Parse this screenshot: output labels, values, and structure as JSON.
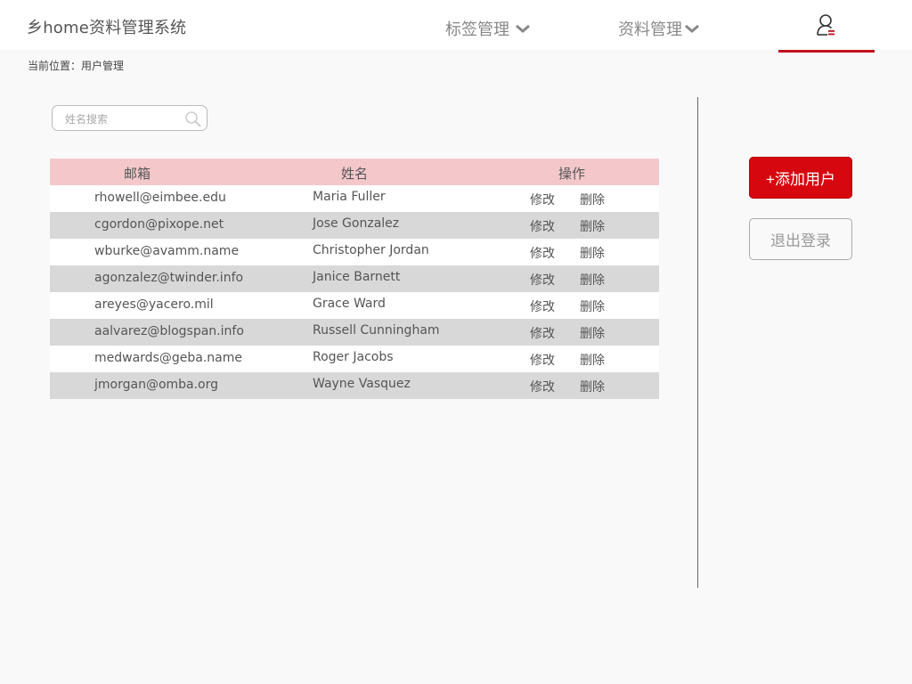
{
  "app": {
    "title": "乡home资料管理系统"
  },
  "nav": {
    "tags_label": "标签管理",
    "data_label": "资料管理",
    "user_icon": "user-icon",
    "accent_color": "#c0111f"
  },
  "breadcrumb": {
    "text": "当前位置：用户管理"
  },
  "search": {
    "placeholder": "姓名搜索",
    "value": ""
  },
  "table": {
    "columns": [
      "邮箱",
      "姓名",
      "操作"
    ],
    "rows": [
      {
        "email": "rhowell@eimbee.edu",
        "name": "Maria Fuller",
        "edit": "修改",
        "delete": "删除"
      },
      {
        "email": "cgordon@pixope.net",
        "name": "Jose Gonzalez",
        "edit": "修改",
        "delete": "删除"
      },
      {
        "email": "wburke@avamm.name",
        "name": "Christopher Jordan",
        "edit": "修改",
        "delete": "删除"
      },
      {
        "email": "agonzalez@twinder.info",
        "name": "Janice Barnett",
        "edit": "修改",
        "delete": "删除"
      },
      {
        "email": "areyes@yacero.mil",
        "name": "Grace Ward",
        "edit": "修改",
        "delete": "删除"
      },
      {
        "email": "aalvarez@blogspan.info",
        "name": "Russell Cunningham",
        "edit": "修改",
        "delete": "删除"
      },
      {
        "email": "medwards@geba.name",
        "name": "Roger Jacobs",
        "edit": "修改",
        "delete": "删除"
      },
      {
        "email": "jmorgan@omba.org",
        "name": "Wayne Vasquez",
        "edit": "修改",
        "delete": "删除"
      }
    ]
  },
  "actions": {
    "add_user": "+添加用户",
    "logout": "退出登录"
  },
  "colors": {
    "header_row": "#f4c8cb",
    "striped_row": "#d8d8d8",
    "primary_button": "#d7070f"
  }
}
